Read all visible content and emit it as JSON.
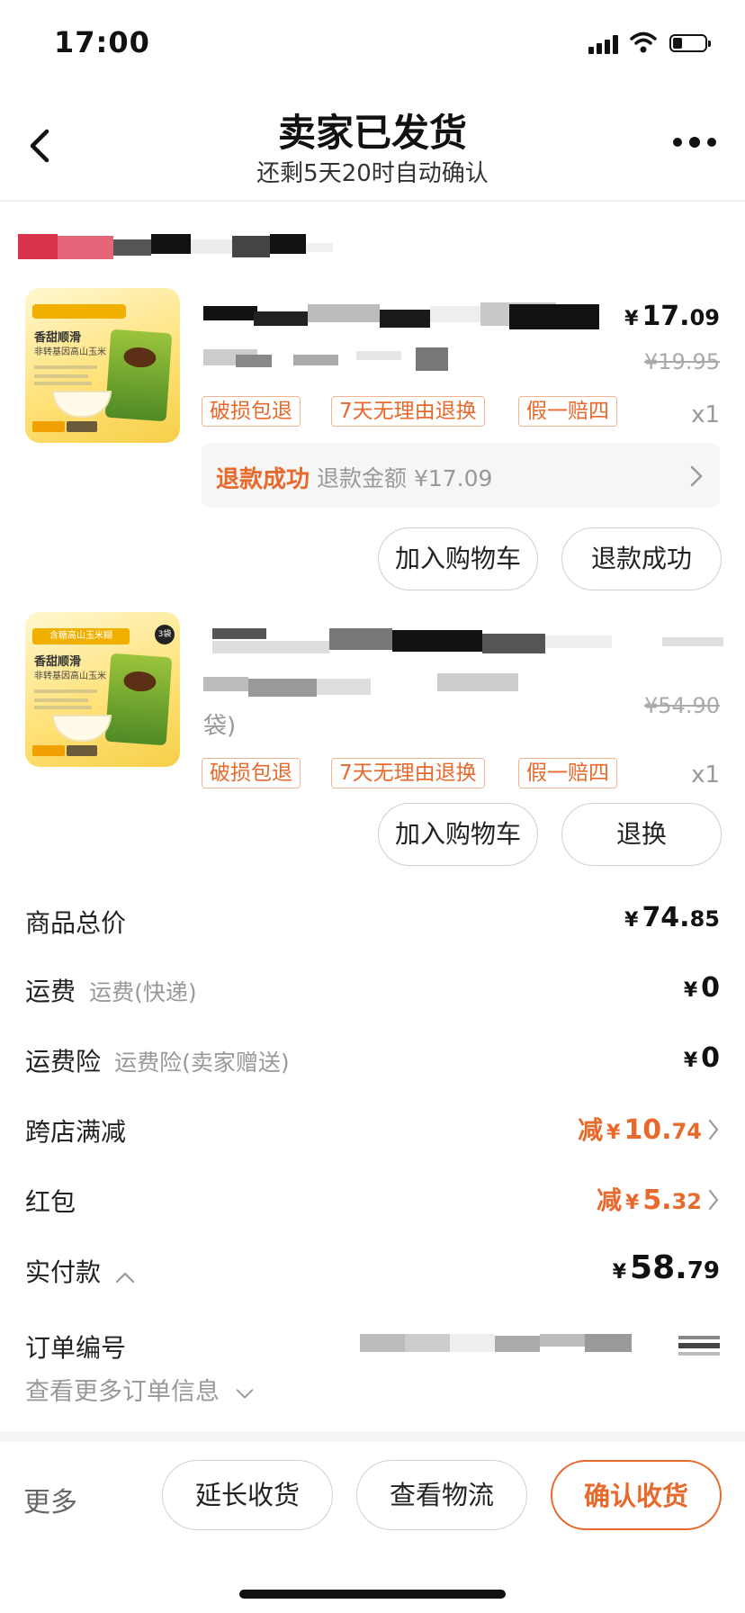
{
  "status_bar": {
    "time": "17:00"
  },
  "header": {
    "title": "卖家已发货",
    "subtitle": "还剩5天20时自动确认"
  },
  "products": [
    {
      "price": {
        "yen": "¥",
        "int": "17.",
        "dec": "09"
      },
      "old_price": "¥19.95",
      "quantity": "x1",
      "tags": [
        "破损包退",
        "7天无理由退换",
        "假一赔四"
      ],
      "refund": {
        "status": "退款成功",
        "amount": "退款金额 ¥17.09"
      },
      "buttons": [
        "加入购物车",
        "退款成功"
      ],
      "thumb": {
        "title": "香甜顺滑",
        "subtitle": "非转基因高山玉米"
      }
    },
    {
      "old_price": "¥54.90",
      "title_tail": "袋)",
      "quantity": "x1",
      "tags": [
        "破损包退",
        "7天无理由退换",
        "假一赔四"
      ],
      "buttons": [
        "加入购物车",
        "退换"
      ],
      "thumb": {
        "title": "香甜顺滑",
        "subtitle": "非转基因高山玉米",
        "band": "含糖高山玉米糊",
        "badge": "3袋"
      }
    }
  ],
  "summary": {
    "goods_total": {
      "label": "商品总价",
      "yen": "¥",
      "int": "74.",
      "dec": "85"
    },
    "shipping": {
      "label": "运费",
      "sub": "运费(快递)",
      "yen": "¥",
      "value": "0"
    },
    "shipping_insurance": {
      "label": "运费险",
      "sub": "运费险(卖家赠送)",
      "yen": "¥",
      "value": "0"
    },
    "cross_store_discount": {
      "label": "跨店满减",
      "prefix": "减",
      "yen": "¥",
      "int": "10.",
      "dec": "74"
    },
    "red_packet": {
      "label": "红包",
      "prefix": "减",
      "yen": "¥",
      "int": "5.",
      "dec": "32"
    },
    "paid": {
      "label": "实付款",
      "yen": "¥",
      "int": "58.",
      "dec": "79"
    },
    "order_number_label": "订单编号",
    "more_info": "查看更多订单信息"
  },
  "footer": {
    "more": "更多",
    "extend": "延长收货",
    "logistics": "查看物流",
    "confirm": "确认收货"
  },
  "colors": {
    "accent": "#e8692c",
    "text": "#222222",
    "muted": "#999999"
  }
}
